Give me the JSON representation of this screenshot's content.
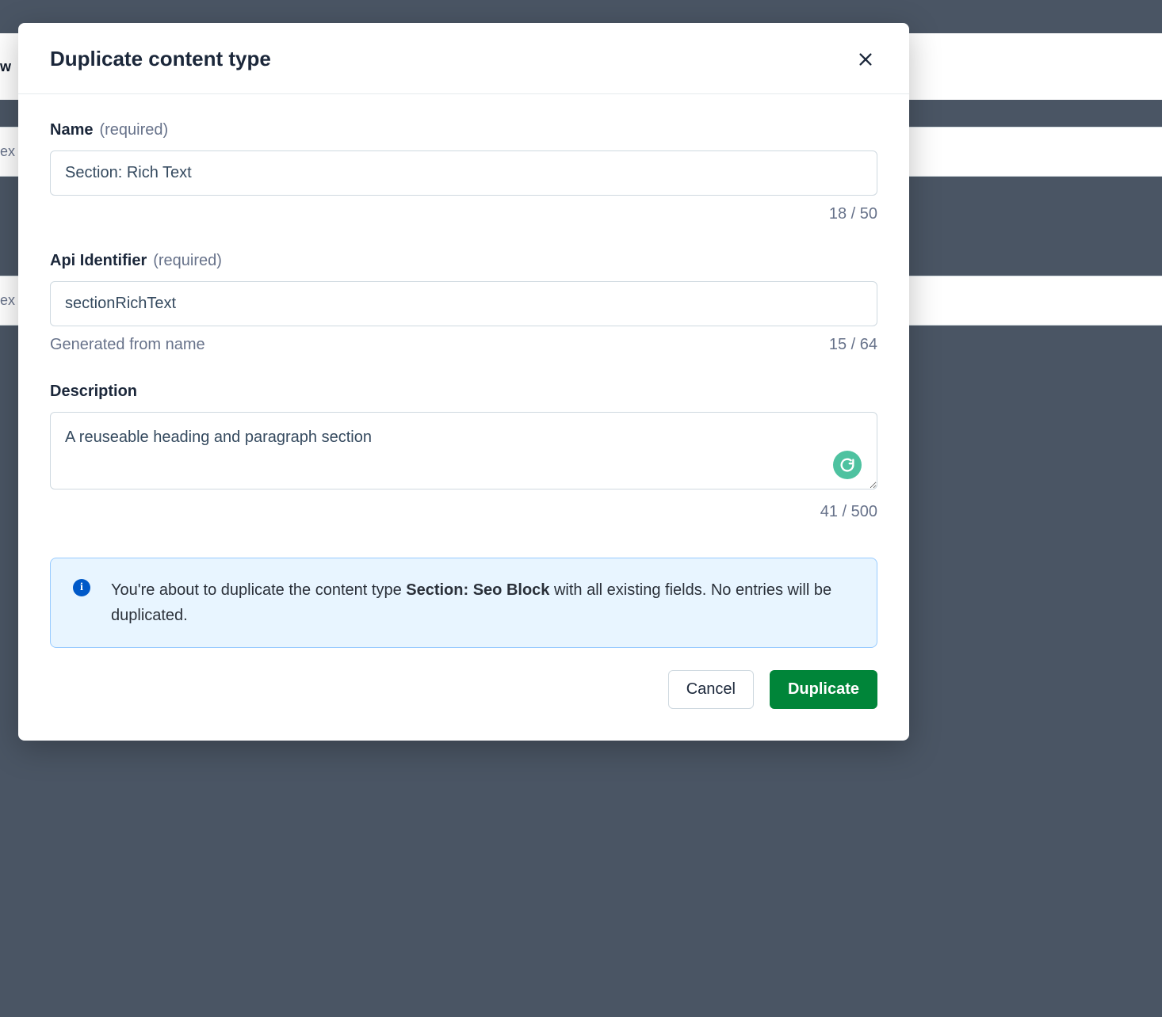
{
  "modal": {
    "title": "Duplicate content type",
    "name_field": {
      "label": "Name",
      "required": "(required)",
      "value": "Section: Rich Text",
      "counter": "18 / 50"
    },
    "api_field": {
      "label": "Api Identifier",
      "required": "(required)",
      "value": "sectionRichText",
      "help": "Generated from name",
      "counter": "15 / 64"
    },
    "description_field": {
      "label": "Description",
      "value": "A reuseable heading and paragraph section",
      "counter": "41 / 500"
    },
    "banner": {
      "prefix": "You're about to duplicate the content type ",
      "bold": "Section: Seo Block",
      "suffix": " with all existing fields. No entries will be duplicated."
    },
    "buttons": {
      "cancel": "Cancel",
      "confirm": "Duplicate"
    }
  },
  "background": {
    "row1": "ex",
    "row2": "ex",
    "header": "w"
  }
}
